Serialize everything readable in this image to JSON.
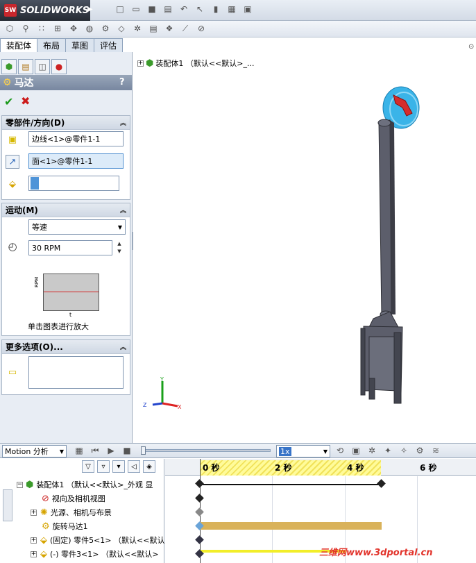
{
  "app": {
    "brand": "SOLIDWORKS",
    "brand_badge": "SW"
  },
  "tabs": [
    {
      "label": "装配体",
      "active": true
    },
    {
      "label": "布局",
      "active": false
    },
    {
      "label": "草图",
      "active": false
    },
    {
      "label": "评估",
      "active": false
    }
  ],
  "property_manager": {
    "title": "马达",
    "help": "?",
    "ok": "✔",
    "cancel": "✖",
    "component_group": {
      "title": "零部件/方向(D)",
      "location_value": "边线<1>@零件1-1",
      "direction_value": "面<1>@零件1-1"
    },
    "motion_group": {
      "title": "运动(M)",
      "type_value": "等速",
      "speed_value": "30 RPM",
      "graph_ylabel": "RPM",
      "graph_xlabel": "t",
      "graph_hint": "单击图表进行放大"
    },
    "more_group": {
      "title": "更多选项(O)..."
    }
  },
  "viewport": {
    "tree_item": "装配体1 （默认<<默认>_..."
  },
  "motion_manager": {
    "study_type": "Motion 分析",
    "speed": "1x",
    "time_labels": [
      "0 秒",
      "2 秒",
      "4 秒",
      "6 秒"
    ],
    "tree": [
      {
        "label": "装配体1 （默认<<默认>_外观 显",
        "icon": "assembly-icon"
      },
      {
        "label": "视向及相机视图",
        "icon": "camera-icon"
      },
      {
        "label": "光源、相机与布景",
        "icon": "light-icon"
      },
      {
        "label": "旋转马达1",
        "icon": "motor-icon"
      },
      {
        "label": "(固定) 零件5<1> （默认<<默认",
        "icon": "part-icon"
      },
      {
        "label": "(-) 零件3<1> （默认<<默认>",
        "icon": "part-icon"
      }
    ]
  },
  "watermark": "三维网www.3dportal.cn",
  "colors": {
    "accent": "#7887a0",
    "timeline_yellow": "#fffb9a",
    "motor_bar": "#d9b25a",
    "part_bar": "#f2ee29",
    "disk": "#3ab4e8"
  }
}
